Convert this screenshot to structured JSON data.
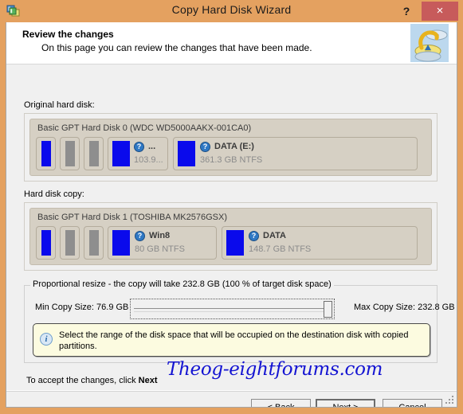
{
  "window": {
    "title": "Copy Hard Disk Wizard",
    "icon": "partition-wizard-icon",
    "help_label": "?",
    "close_label": "×",
    "accent_color": "#e4a160",
    "close_color": "#c75b5b"
  },
  "header": {
    "title": "Review the changes",
    "subtitle": "On this page you can review the changes that have been made.",
    "icon": "disk-copy-illustration-icon"
  },
  "original_disk": {
    "label": "Original hard disk:",
    "disk_title": "Basic GPT Hard Disk 0 (WDC WD5000AAKX-001CA0)",
    "partitions": [
      {
        "name": "",
        "size": "",
        "bar": "blue",
        "show_icon": false
      },
      {
        "name": "",
        "size": "",
        "bar": "gray",
        "show_icon": false
      },
      {
        "name": "",
        "size": "",
        "bar": "gray",
        "show_icon": false
      },
      {
        "name": "...",
        "size": "103.9...",
        "bar": "blue",
        "show_icon": true
      },
      {
        "name": "DATA (E:)",
        "size": "361.3 GB NTFS",
        "bar": "blue",
        "show_icon": true
      }
    ]
  },
  "copy_disk": {
    "label": "Hard disk copy:",
    "disk_title": "Basic GPT Hard Disk 1 (TOSHIBA MK2576GSX)",
    "partitions": [
      {
        "name": "",
        "size": "",
        "bar": "blue",
        "show_icon": false
      },
      {
        "name": "",
        "size": "",
        "bar": "gray",
        "show_icon": false
      },
      {
        "name": "",
        "size": "",
        "bar": "gray",
        "show_icon": false
      },
      {
        "name": "Win8",
        "size": "80 GB NTFS",
        "bar": "blue",
        "show_icon": true
      },
      {
        "name": "DATA",
        "size": "148.7 GB NTFS",
        "bar": "blue",
        "show_icon": true
      }
    ]
  },
  "resize_group": {
    "legend": "Proportional resize - the copy will take 232.8 GB (100 % of target disk space)",
    "min_label": "Min Copy Size:  76.9 GB",
    "max_label": "Max Copy Size:  232.8 GB",
    "slider_value": 100
  },
  "info": {
    "icon": "info-icon",
    "text": "Select the range of the disk space that will be occupied on the destination disk with copied partitions."
  },
  "accept_prefix": "To accept the changes, click ",
  "accept_bold": "Next",
  "watermark": "Theog-eightforums.com",
  "buttons": {
    "back": "< Back",
    "next": "Next >",
    "cancel": "Cancel"
  }
}
